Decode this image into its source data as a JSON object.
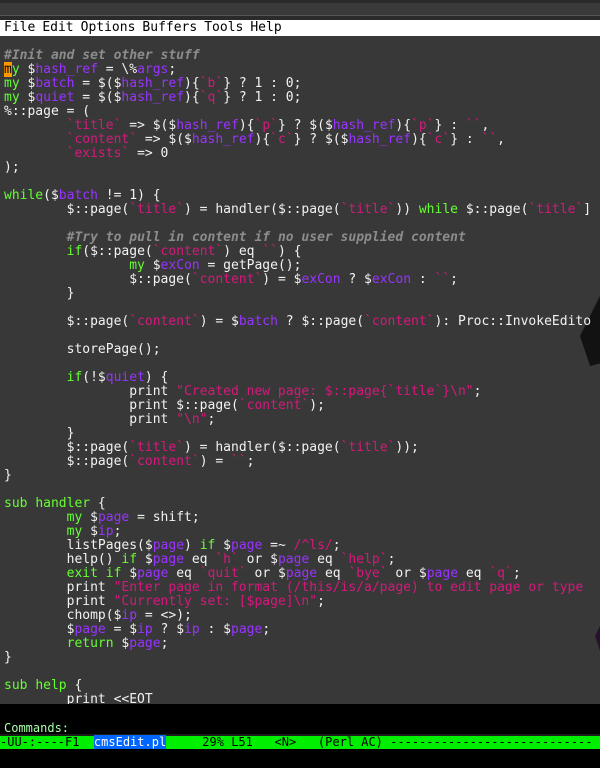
{
  "menubar": {
    "items": [
      "File",
      "Edit",
      "Options",
      "Buffers",
      "Tools",
      "Help"
    ]
  },
  "editor": {
    "lines": [
      [
        {
          "t": "#Init and set other stuff",
          "c": "c"
        }
      ],
      [
        {
          "t": "m",
          "c": "cursor"
        },
        {
          "t": "y",
          "c": "kw"
        },
        {
          "t": " $"
        },
        {
          "t": "hash_ref",
          "c": "v"
        },
        {
          "t": " = \\%"
        },
        {
          "t": "args",
          "c": "v"
        },
        {
          "t": ";"
        }
      ],
      [
        {
          "t": "my",
          "c": "kw"
        },
        {
          "t": " $"
        },
        {
          "t": "batch",
          "c": "v"
        },
        {
          "t": " = $($"
        },
        {
          "t": "hash_ref",
          "c": "v"
        },
        {
          "t": "){"
        },
        {
          "t": "`b`",
          "c": "s"
        },
        {
          "t": "} ? 1 : 0;"
        }
      ],
      [
        {
          "t": "my",
          "c": "kw"
        },
        {
          "t": " $"
        },
        {
          "t": "quiet",
          "c": "v"
        },
        {
          "t": " = $($"
        },
        {
          "t": "hash_ref",
          "c": "v"
        },
        {
          "t": "){"
        },
        {
          "t": "`q`",
          "c": "s"
        },
        {
          "t": "} ? 1 : 0;"
        }
      ],
      [
        {
          "t": "%::page = ("
        }
      ],
      [
        {
          "t": "        "
        },
        {
          "t": "`title`",
          "c": "s"
        },
        {
          "t": " => $($"
        },
        {
          "t": "hash_ref",
          "c": "v"
        },
        {
          "t": "){"
        },
        {
          "t": "`p`",
          "c": "s"
        },
        {
          "t": "} ? $($"
        },
        {
          "t": "hash_ref",
          "c": "v"
        },
        {
          "t": "){"
        },
        {
          "t": "`p`",
          "c": "s"
        },
        {
          "t": "} : "
        },
        {
          "t": "``",
          "c": "s"
        },
        {
          "t": ","
        }
      ],
      [
        {
          "t": "        "
        },
        {
          "t": "`content`",
          "c": "s"
        },
        {
          "t": " => $($"
        },
        {
          "t": "hash_ref",
          "c": "v"
        },
        {
          "t": "){"
        },
        {
          "t": "`c`",
          "c": "s"
        },
        {
          "t": "} ? $($"
        },
        {
          "t": "hash_ref",
          "c": "v"
        },
        {
          "t": "){"
        },
        {
          "t": "`c`",
          "c": "s"
        },
        {
          "t": "} : "
        },
        {
          "t": "``",
          "c": "s"
        },
        {
          "t": ","
        }
      ],
      [
        {
          "t": "        "
        },
        {
          "t": "`exists`",
          "c": "s"
        },
        {
          "t": " => 0"
        }
      ],
      [
        {
          "t": ");"
        }
      ],
      [
        {
          "t": ""
        }
      ],
      [
        {
          "t": "while",
          "c": "kw"
        },
        {
          "t": "($"
        },
        {
          "t": "batch",
          "c": "v"
        },
        {
          "t": " != 1) {"
        }
      ],
      [
        {
          "t": "        $::page("
        },
        {
          "t": "`title`",
          "c": "s"
        },
        {
          "t": ") = handler($::page("
        },
        {
          "t": "`title`",
          "c": "s"
        },
        {
          "t": ")) "
        },
        {
          "t": "while",
          "c": "kw"
        },
        {
          "t": " $::page("
        },
        {
          "t": "`title`",
          "c": "s"
        },
        {
          "t": "]"
        }
      ],
      [
        {
          "t": ""
        }
      ],
      [
        {
          "t": "        "
        },
        {
          "t": "#Try to pull in content if no user supplied content",
          "c": "c"
        }
      ],
      [
        {
          "t": "        "
        },
        {
          "t": "if",
          "c": "kw"
        },
        {
          "t": "($::page("
        },
        {
          "t": "`content`",
          "c": "s"
        },
        {
          "t": ") eq "
        },
        {
          "t": "``",
          "c": "s"
        },
        {
          "t": ") {"
        }
      ],
      [
        {
          "t": "                "
        },
        {
          "t": "my",
          "c": "kw"
        },
        {
          "t": " $"
        },
        {
          "t": "exCon",
          "c": "v"
        },
        {
          "t": " = getPage();"
        }
      ],
      [
        {
          "t": "                $::page("
        },
        {
          "t": "`content`",
          "c": "s"
        },
        {
          "t": ") = $"
        },
        {
          "t": "exCon",
          "c": "v"
        },
        {
          "t": " ? $"
        },
        {
          "t": "exCon",
          "c": "v"
        },
        {
          "t": " : "
        },
        {
          "t": "``",
          "c": "s"
        },
        {
          "t": ";"
        }
      ],
      [
        {
          "t": "        }"
        }
      ],
      [
        {
          "t": ""
        }
      ],
      [
        {
          "t": "        $::page("
        },
        {
          "t": "`content`",
          "c": "s"
        },
        {
          "t": ") = $"
        },
        {
          "t": "batch",
          "c": "v"
        },
        {
          "t": " ? $::page("
        },
        {
          "t": "`content`",
          "c": "s"
        },
        {
          "t": "): Proc::InvokeEdito"
        }
      ],
      [
        {
          "t": ""
        }
      ],
      [
        {
          "t": "        storePage();"
        }
      ],
      [
        {
          "t": ""
        }
      ],
      [
        {
          "t": "        "
        },
        {
          "t": "if",
          "c": "kw"
        },
        {
          "t": "(!$"
        },
        {
          "t": "quiet",
          "c": "v"
        },
        {
          "t": ") {"
        }
      ],
      [
        {
          "t": "                print "
        },
        {
          "t": "\"Created new page: $::page{`title`}\\n\"",
          "c": "s"
        },
        {
          "t": ";"
        }
      ],
      [
        {
          "t": "                print $::page("
        },
        {
          "t": "`content`",
          "c": "s"
        },
        {
          "t": ");"
        }
      ],
      [
        {
          "t": "                print "
        },
        {
          "t": "\"\\n\"",
          "c": "s"
        },
        {
          "t": ";"
        }
      ],
      [
        {
          "t": "        }"
        }
      ],
      [
        {
          "t": "        $::page("
        },
        {
          "t": "`title`",
          "c": "s"
        },
        {
          "t": ") = handler($::page("
        },
        {
          "t": "`title`",
          "c": "s"
        },
        {
          "t": "));"
        }
      ],
      [
        {
          "t": "        $::page("
        },
        {
          "t": "`content`",
          "c": "s"
        },
        {
          "t": ") = "
        },
        {
          "t": "``",
          "c": "s"
        },
        {
          "t": ";"
        }
      ],
      [
        {
          "t": "}"
        }
      ],
      [
        {
          "t": ""
        }
      ],
      [
        {
          "t": "sub",
          "c": "kw"
        },
        {
          "t": " "
        },
        {
          "t": "handler",
          "c": "kw"
        },
        {
          "t": " {"
        }
      ],
      [
        {
          "t": "        "
        },
        {
          "t": "my",
          "c": "kw"
        },
        {
          "t": " $"
        },
        {
          "t": "page",
          "c": "v"
        },
        {
          "t": " = shift;"
        }
      ],
      [
        {
          "t": "        "
        },
        {
          "t": "my",
          "c": "kw"
        },
        {
          "t": " $"
        },
        {
          "t": "ip",
          "c": "v"
        },
        {
          "t": ";"
        }
      ],
      [
        {
          "t": "        listPages($"
        },
        {
          "t": "page",
          "c": "v"
        },
        {
          "t": ") "
        },
        {
          "t": "if",
          "c": "kw"
        },
        {
          "t": " $"
        },
        {
          "t": "page",
          "c": "v"
        },
        {
          "t": " =~ "
        },
        {
          "t": "/^ls/",
          "c": "s"
        },
        {
          "t": ";"
        }
      ],
      [
        {
          "t": "        help() "
        },
        {
          "t": "if",
          "c": "kw"
        },
        {
          "t": " $"
        },
        {
          "t": "page",
          "c": "v"
        },
        {
          "t": " eq "
        },
        {
          "t": "`h`",
          "c": "s"
        },
        {
          "t": " or $"
        },
        {
          "t": "page",
          "c": "v"
        },
        {
          "t": " eq "
        },
        {
          "t": "`help`",
          "c": "s"
        },
        {
          "t": ";"
        }
      ],
      [
        {
          "t": "        "
        },
        {
          "t": "exit",
          "c": "kw"
        },
        {
          "t": " "
        },
        {
          "t": "if",
          "c": "kw"
        },
        {
          "t": " $"
        },
        {
          "t": "page",
          "c": "v"
        },
        {
          "t": " eq "
        },
        {
          "t": "`quit`",
          "c": "s"
        },
        {
          "t": " or $"
        },
        {
          "t": "page",
          "c": "v"
        },
        {
          "t": " eq "
        },
        {
          "t": "`bye`",
          "c": "s"
        },
        {
          "t": " or $"
        },
        {
          "t": "page",
          "c": "v"
        },
        {
          "t": " eq "
        },
        {
          "t": "`q`",
          "c": "s"
        },
        {
          "t": ";"
        }
      ],
      [
        {
          "t": "        print "
        },
        {
          "t": "\"Enter page in format (/this/is/a/page) to edit page or type",
          "c": "s"
        }
      ],
      [
        {
          "t": "        print "
        },
        {
          "t": "\"Currently set: [$page]\\n\"",
          "c": "s"
        },
        {
          "t": ";"
        }
      ],
      [
        {
          "t": "        chomp($"
        },
        {
          "t": "ip",
          "c": "v"
        },
        {
          "t": " = <>);"
        }
      ],
      [
        {
          "t": "        $"
        },
        {
          "t": "page",
          "c": "v"
        },
        {
          "t": " = $"
        },
        {
          "t": "ip",
          "c": "v"
        },
        {
          "t": " ? $"
        },
        {
          "t": "ip",
          "c": "v"
        },
        {
          "t": " : $"
        },
        {
          "t": "page",
          "c": "v"
        },
        {
          "t": ";"
        }
      ],
      [
        {
          "t": "        "
        },
        {
          "t": "return",
          "c": "kw"
        },
        {
          "t": " $"
        },
        {
          "t": "page",
          "c": "v"
        },
        {
          "t": ";"
        }
      ],
      [
        {
          "t": "}"
        }
      ],
      [
        {
          "t": ""
        }
      ],
      [
        {
          "t": "sub",
          "c": "kw"
        },
        {
          "t": " "
        },
        {
          "t": "help",
          "c": "kw"
        },
        {
          "t": " {"
        }
      ],
      [
        {
          "t": "        print <<EOT"
        }
      ]
    ]
  },
  "minibuffer": {
    "prompt": "Commands:"
  },
  "mode_line": {
    "status": "-UU-:----F1  ",
    "buffer": "cmsEdit.pl",
    "position": "     29% L51   <N>   (Perl AC) ",
    "fill": "----------------------------"
  }
}
